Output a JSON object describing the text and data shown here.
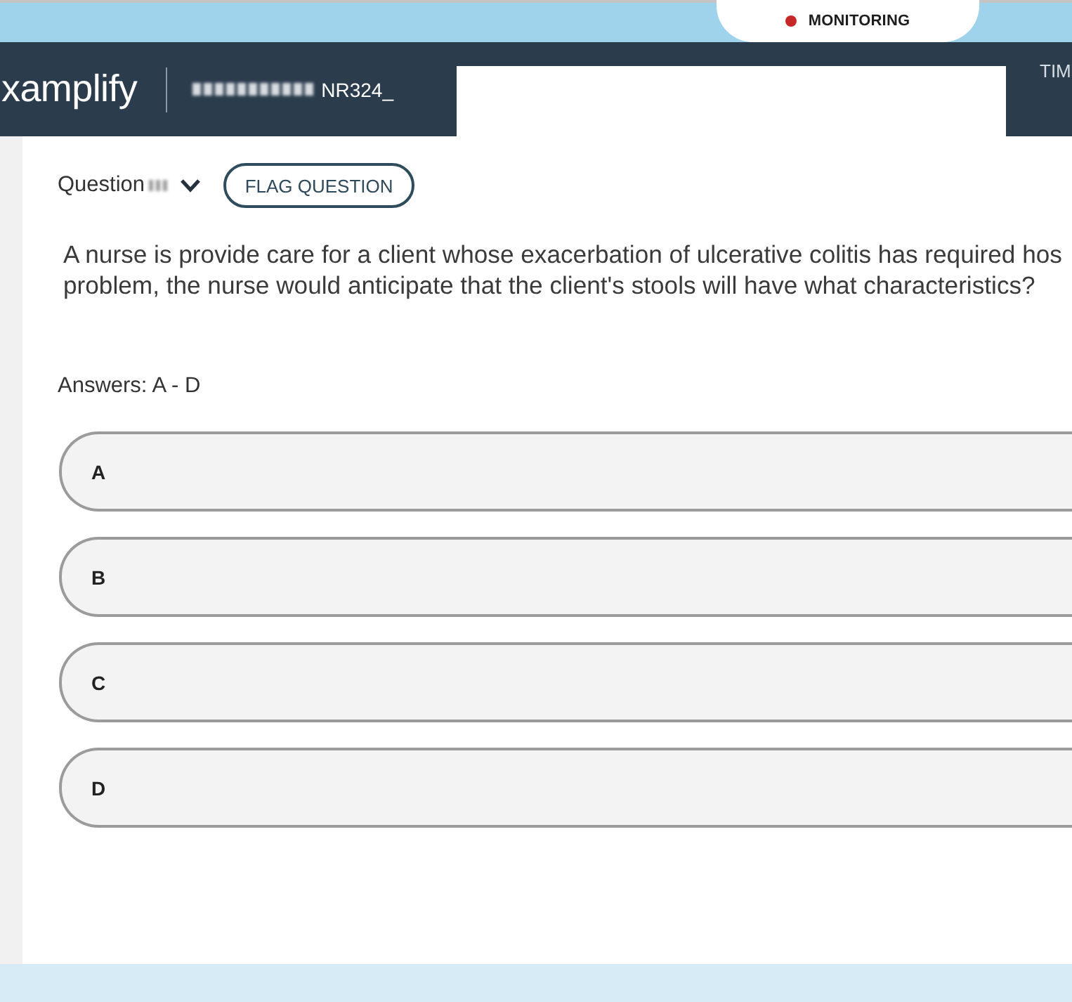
{
  "top_bar": {
    "monitoring": {
      "label": "MONITORING",
      "on": true
    }
  },
  "header": {
    "logo": "xamplify",
    "course": "NR324_",
    "timer_label": "TIM"
  },
  "question": {
    "selector": "Question",
    "flag_button": "FLAG QUESTION",
    "text_lines": [
      "A nurse is provide care for a client whose exacerbation of ulcerative colitis has required hos",
      "problem, the nurse would anticipate that the client's stools will have what characteristics?"
    ]
  },
  "answers": {
    "label": "Answers: A - D",
    "options": [
      {
        "letter": "A",
        "selected": false
      },
      {
        "letter": "B",
        "selected": false
      },
      {
        "letter": "C",
        "selected": false
      },
      {
        "letter": "D",
        "selected": false
      }
    ]
  }
}
